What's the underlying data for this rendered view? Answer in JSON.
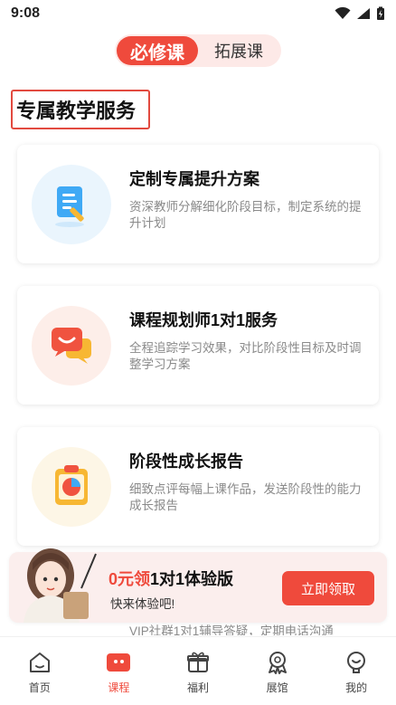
{
  "status_bar": {
    "time": "9:08"
  },
  "tabs": [
    {
      "label": "必修课",
      "active": true
    },
    {
      "label": "拓展课",
      "active": false
    }
  ],
  "section_title": "专属教学服务",
  "cards": [
    {
      "title": "定制专属提升方案",
      "desc": "资深教师分解细化阶段目标，制定系统的提升计划",
      "icon": "document-pen-icon"
    },
    {
      "title": "课程规划师1对1服务",
      "desc": "全程追踪学习效果，对比阶段性目标及时调整学习方案",
      "icon": "chat-bubbles-icon"
    },
    {
      "title": "阶段性成长报告",
      "desc": "细致点评每幅上课作品，发送阶段性的能力成长报告",
      "icon": "report-chart-icon"
    }
  ],
  "partial_card_text": "VIP社群1对1辅导答疑，定期电话沟通",
  "promo": {
    "title_highlight": "0元领",
    "title_rest": "1对1体验版",
    "subtitle": "快来体验吧!",
    "button": "立即领取"
  },
  "nav": [
    {
      "label": "首页",
      "icon": "home-icon",
      "active": false
    },
    {
      "label": "课程",
      "icon": "course-icon",
      "active": true
    },
    {
      "label": "福利",
      "icon": "gift-icon",
      "active": false
    },
    {
      "label": "展馆",
      "icon": "award-icon",
      "active": false
    },
    {
      "label": "我的",
      "icon": "profile-icon",
      "active": false
    }
  ],
  "colors": {
    "accent": "#ef4a3c",
    "tab_bg": "#fde9e7",
    "promo_bg": "#fbeeed"
  }
}
